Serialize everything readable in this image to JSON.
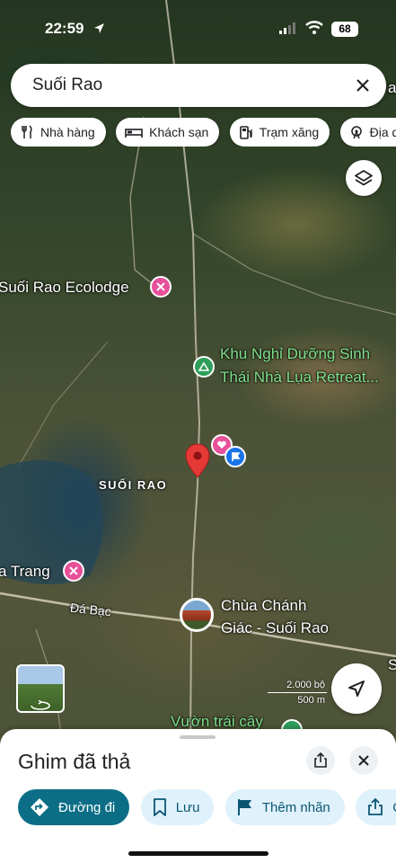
{
  "status_bar": {
    "time": "22:59",
    "battery": "68"
  },
  "search": {
    "query": "Suối Rao"
  },
  "chips": [
    {
      "label": "Nhà hàng",
      "icon": "fork-knife-icon"
    },
    {
      "label": "Khách sạn",
      "icon": "bed-icon"
    },
    {
      "label": "Trạm xăng",
      "icon": "gas-pump-icon"
    },
    {
      "label": "Địa da",
      "icon": "ferris-wheel-icon"
    }
  ],
  "map": {
    "labels": {
      "ecolodge": "Suối Rao Ecolodge",
      "retreat_line1": "Khu Nghỉ Dưỡng Sinh",
      "retreat_line2": "Thái Nhà Lụa Retreat...",
      "area": "SUỐI RAO",
      "trang": "a Trang",
      "da_bac": "Đá Bạc",
      "pagoda_line1": "Chùa Chánh",
      "pagoda_line2": "Giác - Suối Rao",
      "orchard": "Vườn trái cây",
      "edge_right_top": "a",
      "edge_right_mid": "S"
    },
    "scale": {
      "top": "2.000 bộ",
      "bottom": "500 m"
    },
    "colors": {
      "pin": "#e53935",
      "lodge_poi": "#e8509a",
      "park_poi": "#2e9e5b",
      "flag_poi": "#1a73e8"
    }
  },
  "sheet": {
    "title": "Ghim đã thả",
    "actions": [
      {
        "label": "Đường đi",
        "icon": "directions-icon"
      },
      {
        "label": "Lưu",
        "icon": "bookmark-icon"
      },
      {
        "label": "Thêm nhãn",
        "icon": "flag-icon"
      },
      {
        "label": "Ch",
        "icon": "share-icon"
      }
    ]
  }
}
